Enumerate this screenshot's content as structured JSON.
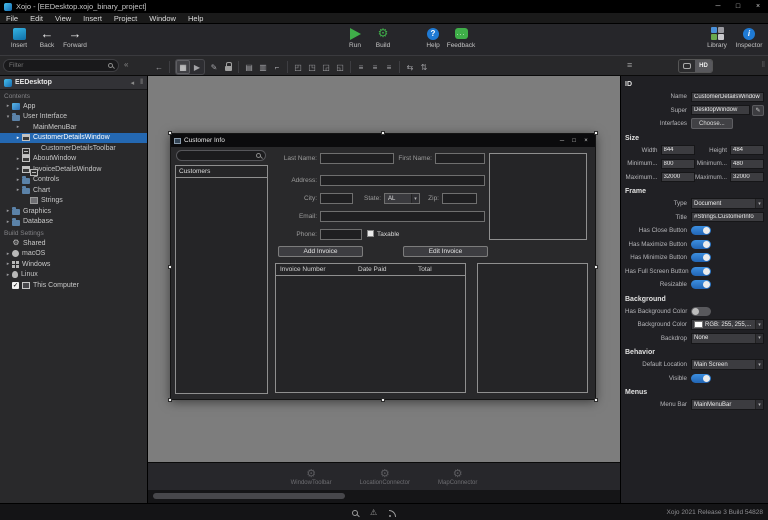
{
  "titlebar": {
    "title": "Xojo - [EEDesktop.xojo_binary_project]"
  },
  "menubar": {
    "items": [
      "File",
      "Edit",
      "View",
      "Insert",
      "Project",
      "Window",
      "Help"
    ]
  },
  "toolbar": {
    "insert_label": "Insert",
    "back_label": "Back",
    "forward_label": "Forward",
    "run_label": "Run",
    "build_label": "Build",
    "help_label": "Help",
    "feedback_label": "Feedback",
    "library_label": "Library",
    "inspector_label": "Inspector",
    "feedback_glyph": "..."
  },
  "editorbar": {
    "filter_placeholder": "Filter",
    "hd_label": "HD",
    "icons": [
      {
        "name": "nav-back",
        "glyph": "←"
      },
      {
        "name": "layout-view",
        "glyph": "▦"
      },
      {
        "name": "preview",
        "glyph": "▶"
      },
      {
        "name": "edit-pencil",
        "glyph": "✎"
      },
      {
        "name": "lock",
        "glyph": ""
      },
      {
        "name": "copy-style",
        "glyph": "▤"
      },
      {
        "name": "paste-style",
        "glyph": "▥"
      },
      {
        "name": "clear-style",
        "glyph": "⌐"
      },
      {
        "name": "corner-tl",
        "glyph": "◰"
      },
      {
        "name": "corner-tr",
        "glyph": "◳"
      },
      {
        "name": "corner-br",
        "glyph": "◲"
      },
      {
        "name": "corner-bl",
        "glyph": "◱"
      },
      {
        "name": "align-left",
        "glyph": "≡"
      },
      {
        "name": "align-center",
        "glyph": "≡"
      },
      {
        "name": "align-right",
        "glyph": "≡"
      },
      {
        "name": "distribute-h",
        "glyph": "⇆"
      },
      {
        "name": "distribute-v",
        "glyph": "⇅"
      }
    ]
  },
  "navigator": {
    "project_name": "EEDesktop",
    "contents_label": "Contents",
    "build_settings_label": "Build Settings",
    "items": [
      {
        "label": "App"
      },
      {
        "label": "User Interface"
      },
      {
        "label": "MainMenuBar"
      },
      {
        "label": "CustomerDetailsWindow"
      },
      {
        "label": "CustomerDetailsToolbar"
      },
      {
        "label": "AboutWindow"
      },
      {
        "label": "InvoiceDetailsWindow"
      },
      {
        "label": "Controls"
      },
      {
        "label": "Chart"
      },
      {
        "label": "Strings"
      },
      {
        "label": "Graphics"
      },
      {
        "label": "Database"
      }
    ],
    "build_items": [
      {
        "label": "Shared"
      },
      {
        "label": "macOS"
      },
      {
        "label": "Windows"
      },
      {
        "label": "Linux"
      },
      {
        "label": "This Computer"
      }
    ]
  },
  "designer": {
    "window_title": "Customer Info",
    "customers_header": "Customers",
    "labels": {
      "last_name": "Last Name:",
      "first_name": "First Name:",
      "address": "Address:",
      "city": "City:",
      "state": "State:",
      "zip": "Zip:",
      "email": "Email:",
      "phone": "Phone:",
      "taxable": "Taxable"
    },
    "state_value": "AL",
    "buttons": {
      "add_invoice": "Add Invoice",
      "edit_invoice": "Edit Invoice"
    },
    "invoice_columns": [
      "Invoice Number",
      "Date Paid",
      "Total"
    ]
  },
  "shelf": {
    "items": [
      {
        "label": "WindowToolbar"
      },
      {
        "label": "LocationConnector"
      },
      {
        "label": "MapConnector"
      }
    ]
  },
  "inspector": {
    "id_section": {
      "title": "ID",
      "name_label": "Name",
      "name_value": "CustomerDetailsWindow",
      "super_label": "Super",
      "super_value": "DesktopWindow",
      "interfaces_label": "Interfaces",
      "interfaces_button": "Choose..."
    },
    "size_section": {
      "title": "Size",
      "width_label": "Width",
      "width_value": "844",
      "height_label": "Height",
      "height_value": "484",
      "min_width_label": "Minimum...",
      "min_width_value": "800",
      "min_height_label": "Minimum...",
      "min_height_value": "480",
      "max_width_label": "Maximum...",
      "max_width_value": "32000",
      "max_height_label": "Maximum...",
      "max_height_value": "32000"
    },
    "frame_section": {
      "title": "Frame",
      "type_label": "Type",
      "type_value": "Document",
      "title_label": "Title",
      "title_value": "#Strings.CustomerInfo",
      "toggles": [
        {
          "label": "Has Close Button",
          "on": true
        },
        {
          "label": "Has Maximize Button",
          "on": true
        },
        {
          "label": "Has Minimize Button",
          "on": true
        },
        {
          "label": "Has Full Screen Button",
          "on": true
        },
        {
          "label": "Resizable",
          "on": true
        }
      ]
    },
    "background_section": {
      "title": "Background",
      "has_bg_label": "Has Background Color",
      "has_bg_on": false,
      "bg_color_label": "Background Color",
      "bg_color_value": "RGB: 255, 255,...",
      "backdrop_label": "Backdrop",
      "backdrop_value": "None"
    },
    "behavior_section": {
      "title": "Behavior",
      "default_location_label": "Default Location",
      "default_location_value": "Main Screen",
      "visible_label": "Visible",
      "visible_on": true
    },
    "menus_section": {
      "title": "Menus",
      "menu_bar_label": "Menu Bar",
      "menu_bar_value": "MainMenuBar"
    }
  },
  "statusbar": {
    "version": "Xojo 2021 Release 3 Build 54828"
  },
  "icons": {
    "chevron_right": "▸",
    "chevron_down": "▾",
    "check": "✓",
    "gear": "⚙",
    "warning": "⚠",
    "minimize": "─",
    "maximize": "□",
    "close": "×",
    "collapse_left": "◂",
    "grip": "‖",
    "collapse": "«",
    "back": "←",
    "forward": "→",
    "question": "?",
    "info": "i",
    "select_arrow": "▾"
  },
  "colors": {
    "selection_blue": "#2468b2",
    "toggle_on": "#2e7cd6",
    "run_green": "#3fae49",
    "canvas_gray": "#7d7d7d"
  }
}
